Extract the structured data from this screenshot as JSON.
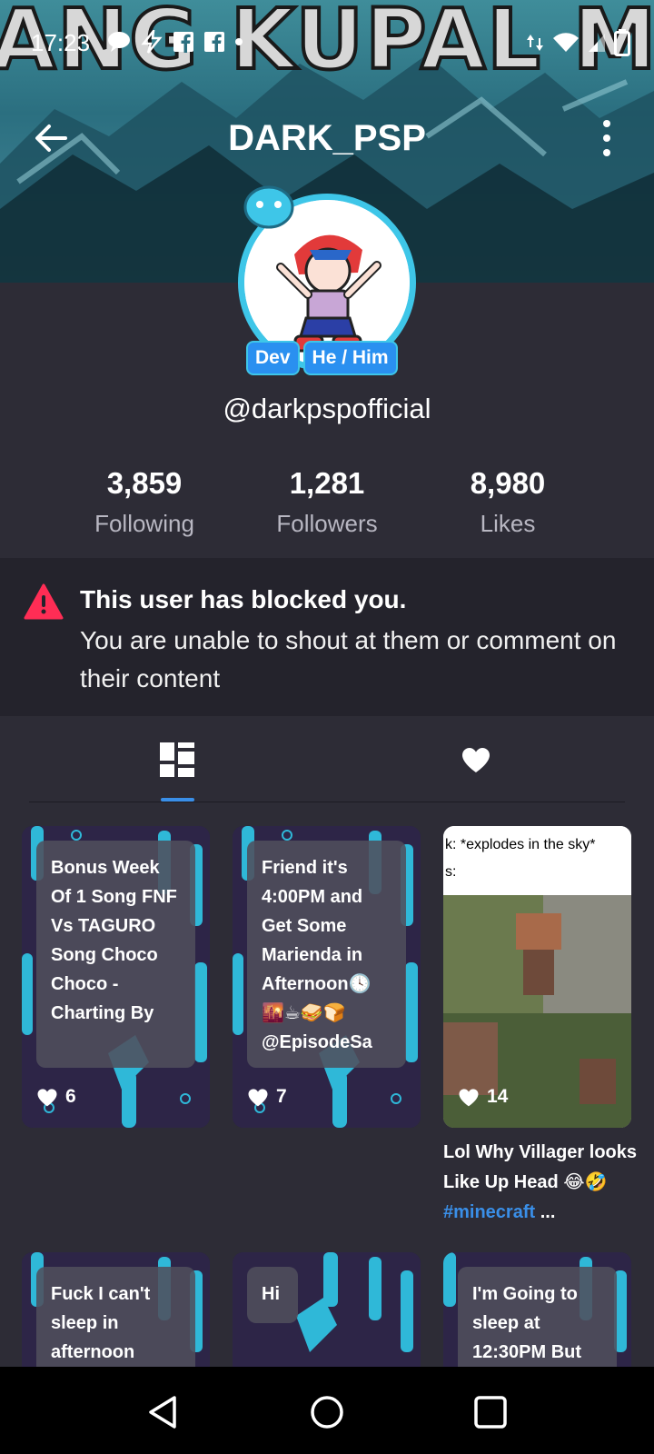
{
  "status_bar": {
    "time": "17:23",
    "icons": [
      "chat-bubble-icon",
      "bolt-icon",
      "facebook-icon",
      "facebook-icon",
      "dot-icon",
      "wifi-icon",
      "signal-icon",
      "battery-icon"
    ]
  },
  "banner": {
    "text": "ANG KUPAL MO"
  },
  "header": {
    "title": "DARK_PSP"
  },
  "profile": {
    "badges": [
      "Dev",
      "He / Him"
    ],
    "handle": "@darkpspofficial",
    "stats": [
      {
        "value": "3,859",
        "label": "Following"
      },
      {
        "value": "1,281",
        "label": "Followers"
      },
      {
        "value": "8,980",
        "label": "Likes"
      }
    ]
  },
  "notice": {
    "title": "This user has blocked you.",
    "body": "You are unable to shout at them or comment on their content"
  },
  "tabs": [
    {
      "icon": "grid-icon",
      "active": true
    },
    {
      "icon": "heart-icon",
      "active": false
    }
  ],
  "posts": [
    {
      "caption": "Bonus Week Of 1 Song FNF Vs TAGURO Song Choco Choco - Charting By",
      "likes": "6"
    },
    {
      "caption": "Friend it's 4:00PM and Get Some Marienda in Afternoon🕓🌇☕🥪🍞 @EpisodeSa",
      "likes": "7"
    },
    {
      "meme_top_line1": "k: *explodes in the sky*",
      "meme_top_line2": "s:",
      "likes": "14",
      "title": "Lol Why Villager looks Like Up Head 😂🤣",
      "hashtag": "#minecraft",
      "ellipsis": " ..."
    },
    {
      "caption": "Fuck I can't sleep in afternoon"
    },
    {
      "caption": "Hi"
    },
    {
      "caption": "I'm Going to sleep at 12:30PM But"
    }
  ],
  "colors": {
    "background": "#2d2c36",
    "notice_bg": "#24232c",
    "accent": "#3a8fe8",
    "warning": "#ff2d55"
  }
}
